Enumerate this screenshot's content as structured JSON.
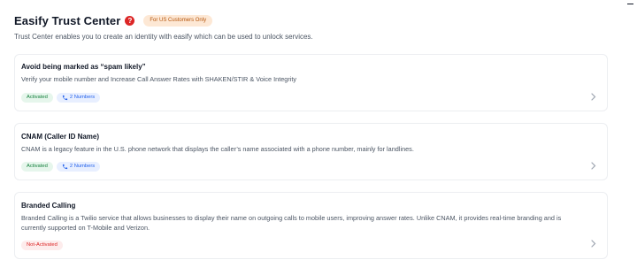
{
  "header": {
    "title": "Easify Trust Center",
    "help_icon": "?",
    "region_badge": "For US Customers Only",
    "subtitle": "Trust Center enables you to create an identity with easify which can be used to unlock services."
  },
  "cards": [
    {
      "title": "Avoid being marked as “spam likely”",
      "description": "Verify your mobile number and Increase Call Answer Rates with SHAKEN/STIR & Voice Integrity",
      "status": "Activated",
      "numbers": "2 Numbers"
    },
    {
      "title": "CNAM (Caller ID Name)",
      "description": "CNAM is a legacy feature in the U.S. phone network that displays the caller’s name associated with a phone number, mainly for landlines.",
      "status": "Activated",
      "numbers": "2 Numbers"
    },
    {
      "title": "Branded Calling",
      "description": "Branded Calling is a Twilio service that allows businesses to display their name on outgoing calls to mobile users, improving answer rates. Unlike CNAM, it provides real-time branding and is currently supported on T-Mobile and Verizon.",
      "status": "Not-Activated"
    }
  ],
  "icons": {
    "help": "question-circle-icon",
    "phone": "phone-icon",
    "chevron": "chevron-right-icon"
  },
  "colors": {
    "help_red": "#dc2626",
    "activated_bg": "#e6f6ec",
    "activated_text": "#15803d",
    "numbers_bg": "#e8efff",
    "numbers_text": "#2563eb",
    "not_activated_bg": "#fdecec",
    "not_activated_text": "#dc2626",
    "region_badge_bg": "#fde8d5",
    "region_badge_text": "#b45309"
  }
}
